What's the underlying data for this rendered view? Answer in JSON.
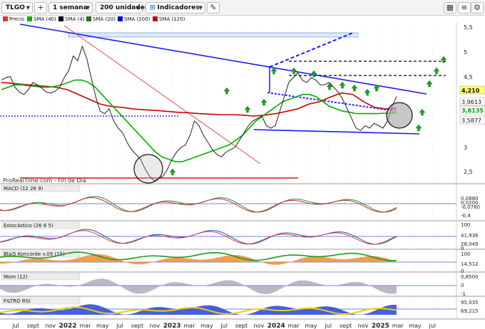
{
  "toolbar": {
    "ticker": "TLGO",
    "period": "1 semana",
    "units": "200 unidades",
    "indicators": "Indicadores"
  },
  "legend": {
    "items": [
      {
        "label": "Precio",
        "color": "#e03030"
      },
      {
        "label": "SMA (40)",
        "color": "#00b000"
      },
      {
        "label": "SMA (4)",
        "color": "#000000"
      },
      {
        "label": "SMA (20)",
        "color": "#2d6b1f"
      },
      {
        "label": "SMA (200)",
        "color": "#0000cc"
      },
      {
        "label": "SMA (120)",
        "color": "#cc0000"
      }
    ]
  },
  "source_label": "ProRealTime.com - Fin de Día",
  "price_axis": [
    "5,5",
    "5",
    "4,5",
    "3",
    "2,5"
  ],
  "price_tags": [
    {
      "text": "4,210",
      "bg": "#ffff66",
      "fg": "#111"
    },
    {
      "text": "3,9613",
      "bg": "#ffffff",
      "fg": "#111"
    },
    {
      "text": "3,8135",
      "bg": "#ffffff",
      "fg": "#00a000"
    },
    {
      "text": "3,5877",
      "bg": "#ffffff",
      "fg": "#111"
    }
  ],
  "panels": {
    "macd": {
      "label": "MACD (12 26 9)",
      "axis": [
        "0,0880",
        "0,0200",
        "-0,0780",
        "-0,4"
      ]
    },
    "stoch": {
      "label": "Estocástico (26 8 5)",
      "axis": [
        "100",
        "41,936",
        "28,049",
        "0"
      ]
    },
    "blai": {
      "label": "Blai5 Koncorde v.09 (15)",
      "axis": [
        "100",
        "14,512",
        "0"
      ]
    },
    "mom": {
      "label": "Mom (12)",
      "axis": [
        "0,8500",
        "0",
        "-1"
      ]
    },
    "filtro": {
      "label": "FILTRO RSI",
      "axis": [
        "95,035",
        "69,215"
      ]
    }
  },
  "time_axis": [
    {
      "label": "jul",
      "bold": false
    },
    {
      "label": "sept",
      "bold": false
    },
    {
      "label": "nov",
      "bold": false
    },
    {
      "label": "2022",
      "bold": true
    },
    {
      "label": "mar",
      "bold": false
    },
    {
      "label": "may",
      "bold": false
    },
    {
      "label": "jul",
      "bold": false
    },
    {
      "label": "sept",
      "bold": false
    },
    {
      "label": "nov",
      "bold": false
    },
    {
      "label": "2023",
      "bold": true
    },
    {
      "label": "mar",
      "bold": false
    },
    {
      "label": "may",
      "bold": false
    },
    {
      "label": "jul",
      "bold": false
    },
    {
      "label": "sept",
      "bold": false
    },
    {
      "label": "nov",
      "bold": false
    },
    {
      "label": "2024",
      "bold": true
    },
    {
      "label": "mar",
      "bold": false
    },
    {
      "label": "may",
      "bold": false
    },
    {
      "label": "jul",
      "bold": false
    },
    {
      "label": "sept",
      "bold": false
    },
    {
      "label": "nov",
      "bold": false
    },
    {
      "label": "2025",
      "bold": true
    },
    {
      "label": "mar",
      "bold": false
    },
    {
      "label": "may",
      "bold": false
    },
    {
      "label": "jul",
      "bold": false
    }
  ],
  "chart_data": {
    "type": "line",
    "price_range": [
      2.3,
      5.6
    ],
    "price_series": [
      4.55,
      4.6,
      4.62,
      4.4,
      4.3,
      4.25,
      4.35,
      4.5,
      4.45,
      4.38,
      4.3,
      4.28,
      4.32,
      4.4,
      4.6,
      4.75,
      5.05,
      4.95,
      5.25,
      5.0,
      4.6,
      4.2,
      3.9,
      3.85,
      3.95,
      3.7,
      3.55,
      3.45,
      3.25,
      3.1,
      3.0,
      2.9,
      2.7,
      2.55,
      2.45,
      2.5,
      2.55,
      2.7,
      2.9,
      3.05,
      3.15,
      3.2,
      3.4,
      3.7,
      3.6,
      3.4,
      3.25,
      3.1,
      3.0,
      2.95,
      3.05,
      3.1,
      3.15,
      3.3,
      3.45,
      3.6,
      3.7,
      3.75,
      3.8,
      3.6,
      3.55,
      3.6,
      3.9,
      4.2,
      4.5,
      4.6,
      4.7,
      4.55,
      4.5,
      4.6,
      4.55,
      4.45,
      4.45,
      4.5,
      4.4,
      4.3,
      4.15,
      3.95,
      3.75,
      3.55,
      3.5,
      3.6,
      3.55,
      3.65,
      3.6,
      3.55,
      3.7,
      4.0,
      4.21
    ],
    "sma40": [
      4.35,
      4.4,
      4.45,
      4.45,
      4.43,
      4.42,
      4.4,
      4.4,
      4.42,
      4.45,
      4.5,
      4.55,
      4.55,
      4.5,
      4.4,
      4.25,
      4.1,
      3.95,
      3.8,
      3.65,
      3.5,
      3.35,
      3.2,
      3.05,
      2.95,
      2.9,
      2.85,
      2.85,
      2.9,
      2.95,
      3.0,
      3.05,
      3.1,
      3.15,
      3.2,
      3.3,
      3.4,
      3.55,
      3.7,
      3.8,
      3.9,
      4.0,
      4.1,
      4.15,
      4.2,
      4.25,
      4.25,
      4.2,
      4.1,
      4.0,
      3.95,
      3.9,
      3.88,
      3.85,
      3.85,
      3.85,
      3.85,
      3.86,
      3.86,
      3.87
    ],
    "sma120": [
      4.5,
      4.48,
      4.46,
      4.44,
      4.42,
      4.4,
      4.35,
      4.25,
      4.15,
      4.05,
      4.0,
      3.98,
      3.95,
      3.93,
      3.92,
      3.9,
      3.88,
      3.87,
      3.85,
      3.84,
      3.83,
      3.83,
      3.82,
      3.8,
      3.82,
      3.85,
      3.9,
      3.95,
      4.05,
      4.1,
      4.2,
      4.28,
      4.25,
      4.1,
      3.98,
      3.95,
      3.96
    ],
    "annotations": [
      "trend-channel",
      "support-line",
      "circle-low",
      "circle-recent"
    ]
  }
}
